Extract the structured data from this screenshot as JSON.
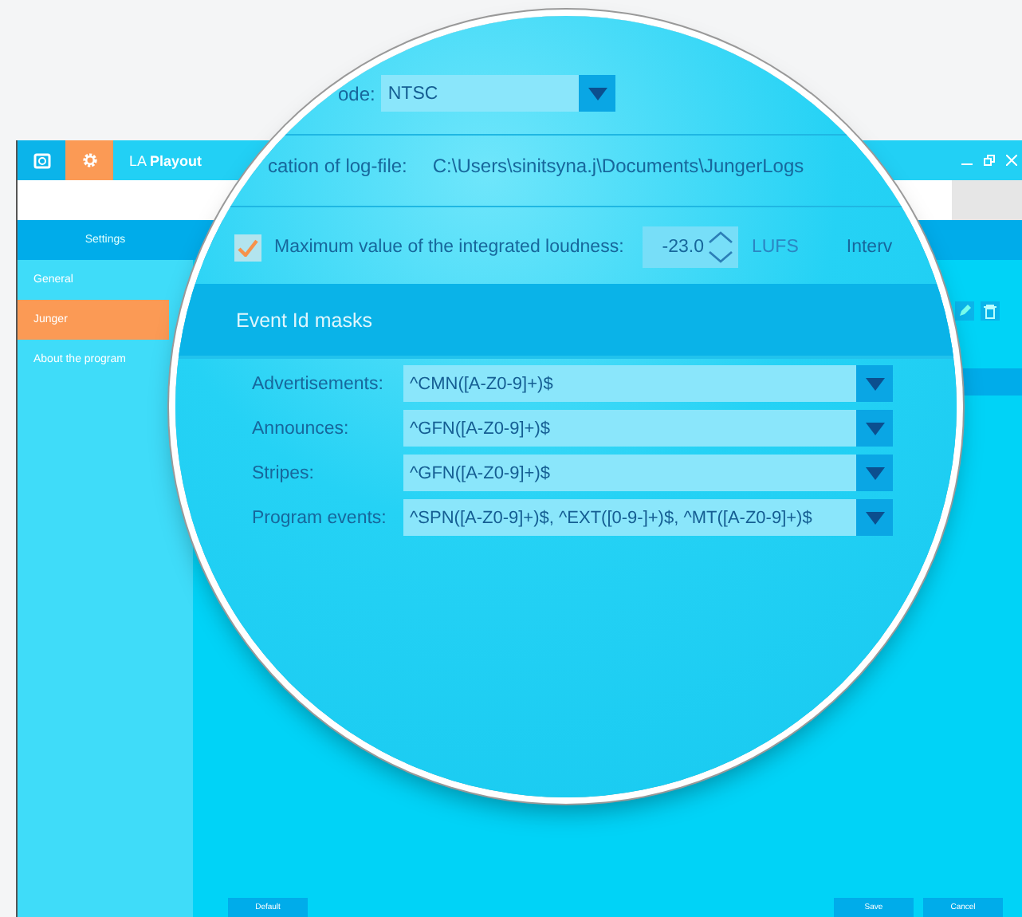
{
  "window": {
    "title": "LA **Playout**"
  },
  "nav_tabs": [
    {
      "kind": "screen",
      "selected": false
    },
    {
      "kind": "gear",
      "selected": true
    }
  ],
  "sidebar": {
    "header": "Settings",
    "items": [
      {
        "label": "General",
        "selected": false
      },
      {
        "label": "Junger",
        "selected": true
      },
      {
        "label": "About the program",
        "selected": false
      }
    ]
  },
  "footer": {
    "left_buttons": [
      "Default"
    ],
    "right_buttons": [
      "Save",
      "Cancel"
    ]
  },
  "magnifier": {
    "video_mode": {
      "label": "ode:",
      "value": "NTSC"
    },
    "log_file": {
      "label": "cation of log-file:",
      "value": "C:\\Users\\sinitsyna.j\\Documents\\JungerLogs"
    },
    "loudness": {
      "checked": true,
      "label": "Maximum value of the integrated loudness:",
      "value": "-23.0",
      "unit": "LUFS",
      "next_label": "Interv"
    },
    "masks": {
      "title": "Event Id masks",
      "rows": [
        {
          "label": "Advertisements:",
          "value": "^CMN([A-Z0-9]+)$"
        },
        {
          "label": "Announces:",
          "value": "^GFN([A-Z0-9]+)$"
        },
        {
          "label": "Stripes:",
          "value": "^GFN([A-Z0-9]+)$"
        },
        {
          "label": "Program events:",
          "value": "^SPN([A-Z0-9]+)$, ^EXT([0-9-]+)$, ^MT([A-Z0-9]+)$"
        }
      ]
    }
  }
}
